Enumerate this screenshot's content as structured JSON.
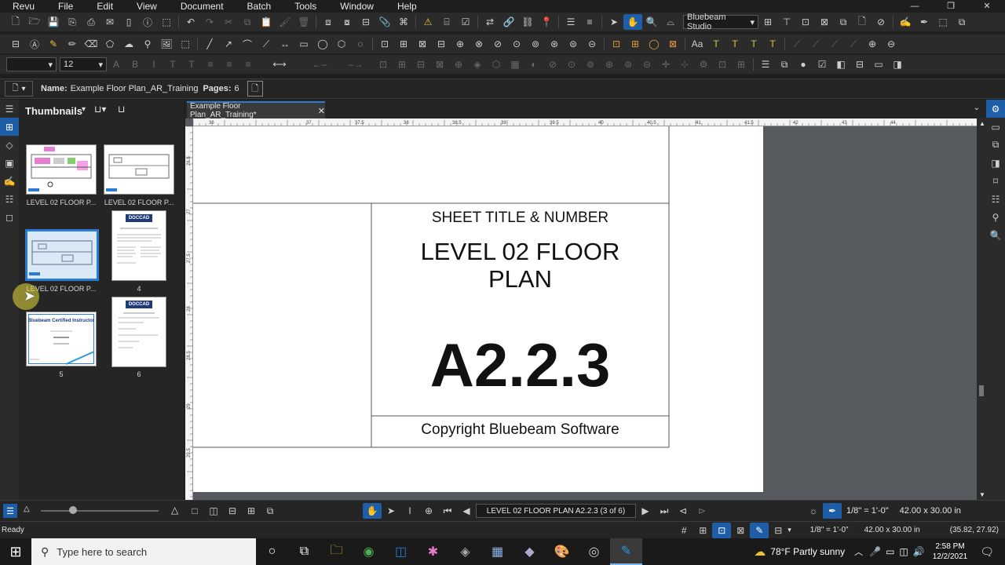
{
  "menu": [
    "Revu",
    "File",
    "Edit",
    "View",
    "Document",
    "Batch",
    "Tools",
    "Window",
    "Help"
  ],
  "profile_combo": "Bluebeam Studio",
  "font_size_value": "12",
  "info": {
    "name_label": "Name:",
    "name_value": "Example Floor Plan_AR_Training",
    "pages_label": "Pages:",
    "pages_value": "6"
  },
  "panel": {
    "title": "Thumbnails",
    "thumbs": [
      {
        "label": "LEVEL 02 FLOOR P..."
      },
      {
        "label": "LEVEL 02 FLOOR P..."
      },
      {
        "label": "LEVEL 02 FLOOR P..."
      },
      {
        "label": "4"
      },
      {
        "label": "5"
      },
      {
        "label": "6"
      }
    ],
    "thumb4_logo": "DOCCAD",
    "thumb6_logo": "DOCCAD",
    "thumb5_title": "Bluebeam Certified Instructor"
  },
  "doc_tab": "Example Floor Plan_AR_Training*",
  "ruler_ticks": [
    "36",
    "",
    "37",
    "37.5",
    "38",
    "38.5",
    "39",
    "39.5",
    "40",
    "40.5",
    "41",
    "41.5",
    "42",
    "43",
    "44"
  ],
  "vruler_ticks": [
    "26.5",
    "27",
    "27.5",
    "28",
    "28.5",
    "29",
    "29.5",
    "30"
  ],
  "titleblock": {
    "sheet_label": "SHEET TITLE & NUMBER",
    "title_line1": "LEVEL 02 FLOOR",
    "title_line2": "PLAN",
    "number": "A2.2.3",
    "copyright": "Copyright Bluebeam Software"
  },
  "nav": {
    "page_field": "LEVEL 02 FLOOR PLAN A2.2.3 (3 of 6)",
    "scale": "1/8\" = 1'-0\"",
    "size": "42.00 x 30.00 in"
  },
  "status": {
    "ready": "Ready",
    "scale": "1/8\" = 1'-0\"",
    "size": "42.00 x 30.00 in",
    "coords": "(35.82, 27.92)"
  },
  "taskbar": {
    "search_placeholder": "Type here to search",
    "weather": "78°F  Partly sunny",
    "time": "2:58 PM",
    "date": "12/2/2021"
  },
  "colors": {
    "accent": "#2a7ad8",
    "selected_tool": "#1e5ea8"
  }
}
